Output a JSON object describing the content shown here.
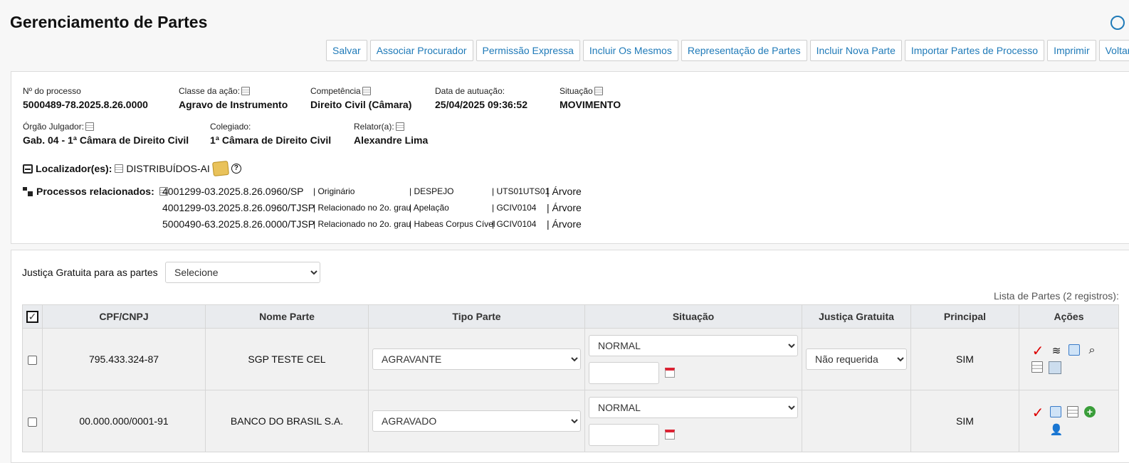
{
  "page": {
    "title": "Gerenciamento de Partes"
  },
  "toolbar": [
    "Salvar",
    "Associar Procurador",
    "Permissão Expressa",
    "Incluir Os Mesmos",
    "Representação de Partes",
    "Incluir Nova Parte",
    "Importar Partes de Processo",
    "Imprimir",
    "Voltar"
  ],
  "process": {
    "numero_label": "Nº do processo",
    "numero": "5000489-78.2025.8.26.0000",
    "classe_label": "Classe da ação:",
    "classe": "Agravo de Instrumento",
    "competencia_label": "Competência",
    "competencia": "Direito Civil (Câmara)",
    "data_label": "Data de autuação:",
    "data": "25/04/2025 09:36:52",
    "situacao_label": "Situação",
    "situacao": "MOVIMENTO",
    "orgao_label": "Órgão Julgador:",
    "orgao": "Gab. 04 - 1ª Câmara de Direito Civil",
    "colegiado_label": "Colegiado:",
    "colegiado": "1ª Câmara de Direito Civil",
    "relator_label": "Relator(a):",
    "relator": "Alexandre Lima"
  },
  "localizador": {
    "label": "Localizador(es):",
    "value": "DISTRIBUÍDOS-AI"
  },
  "related": {
    "label": "Processos relacionados:",
    "rows": [
      {
        "numero": "4001299-03.2025.8.26.0960/SP",
        "tipo": "| Originário",
        "classe": "| DESPEJO",
        "orgao": "| UTS01UTS01",
        "arvore": "| Árvore"
      },
      {
        "numero": "4001299-03.2025.8.26.0960/TJSP",
        "tipo": "| Relacionado no 2o. grau",
        "classe": "| Apelação",
        "orgao": "| GCIV0104",
        "arvore": "| Árvore"
      },
      {
        "numero": "5000490-63.2025.8.26.0000/TJSP",
        "tipo": "| Relacionado no 2o. grau",
        "classe": "| Habeas Corpus Cível",
        "orgao": "| GCIV0104",
        "arvore": "| Árvore"
      }
    ]
  },
  "justica": {
    "label": "Justiça Gratuita para as partes",
    "selected": "Selecione"
  },
  "list": {
    "count": "Lista de Partes (2 registros):",
    "headers": {
      "cpf": "CPF/CNPJ",
      "nome": "Nome Parte",
      "tipo": "Tipo Parte",
      "situacao": "Situação",
      "justica": "Justiça Gratuita",
      "principal": "Principal",
      "acoes": "Ações"
    },
    "rows": [
      {
        "cpf": "795.433.324-87",
        "nome": "SGP TESTE CEL",
        "tipo": "AGRAVANTE",
        "situacao": "NORMAL",
        "justica": "Não requerida",
        "principal": "SIM"
      },
      {
        "cpf": "00.000.000/0001-91",
        "nome": "BANCO DO BRASIL S.A.",
        "tipo": "AGRAVADO",
        "situacao": "NORMAL",
        "justica": "",
        "principal": "SIM"
      }
    ]
  }
}
